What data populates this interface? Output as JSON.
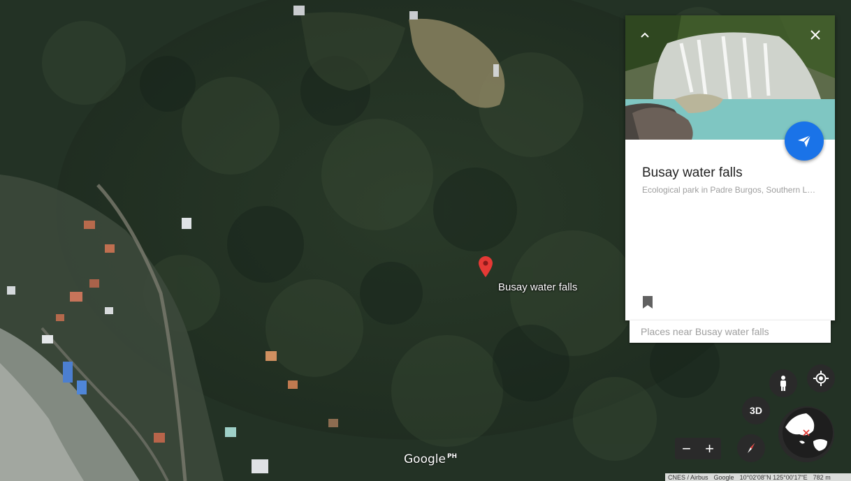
{
  "map": {
    "place_label": "Busay water falls",
    "logo_text": "Google",
    "logo_region": "PH"
  },
  "card": {
    "title": "Busay water falls",
    "subtitle": "Ecological park in Padre Burgos, Southern Leyte",
    "nearby_placeholder": "Places near Busay water falls"
  },
  "controls": {
    "three_d_label": "3D",
    "zoom_out_label": "−",
    "zoom_in_label": "+"
  },
  "attribution": {
    "data_credit": "CNES / Airbus",
    "brand": "Google",
    "coordinates": "10°02'08\"N 125°00'17\"E",
    "scale": "782 m"
  },
  "colors": {
    "accent": "#1a73e8",
    "pin": "#e53935"
  }
}
